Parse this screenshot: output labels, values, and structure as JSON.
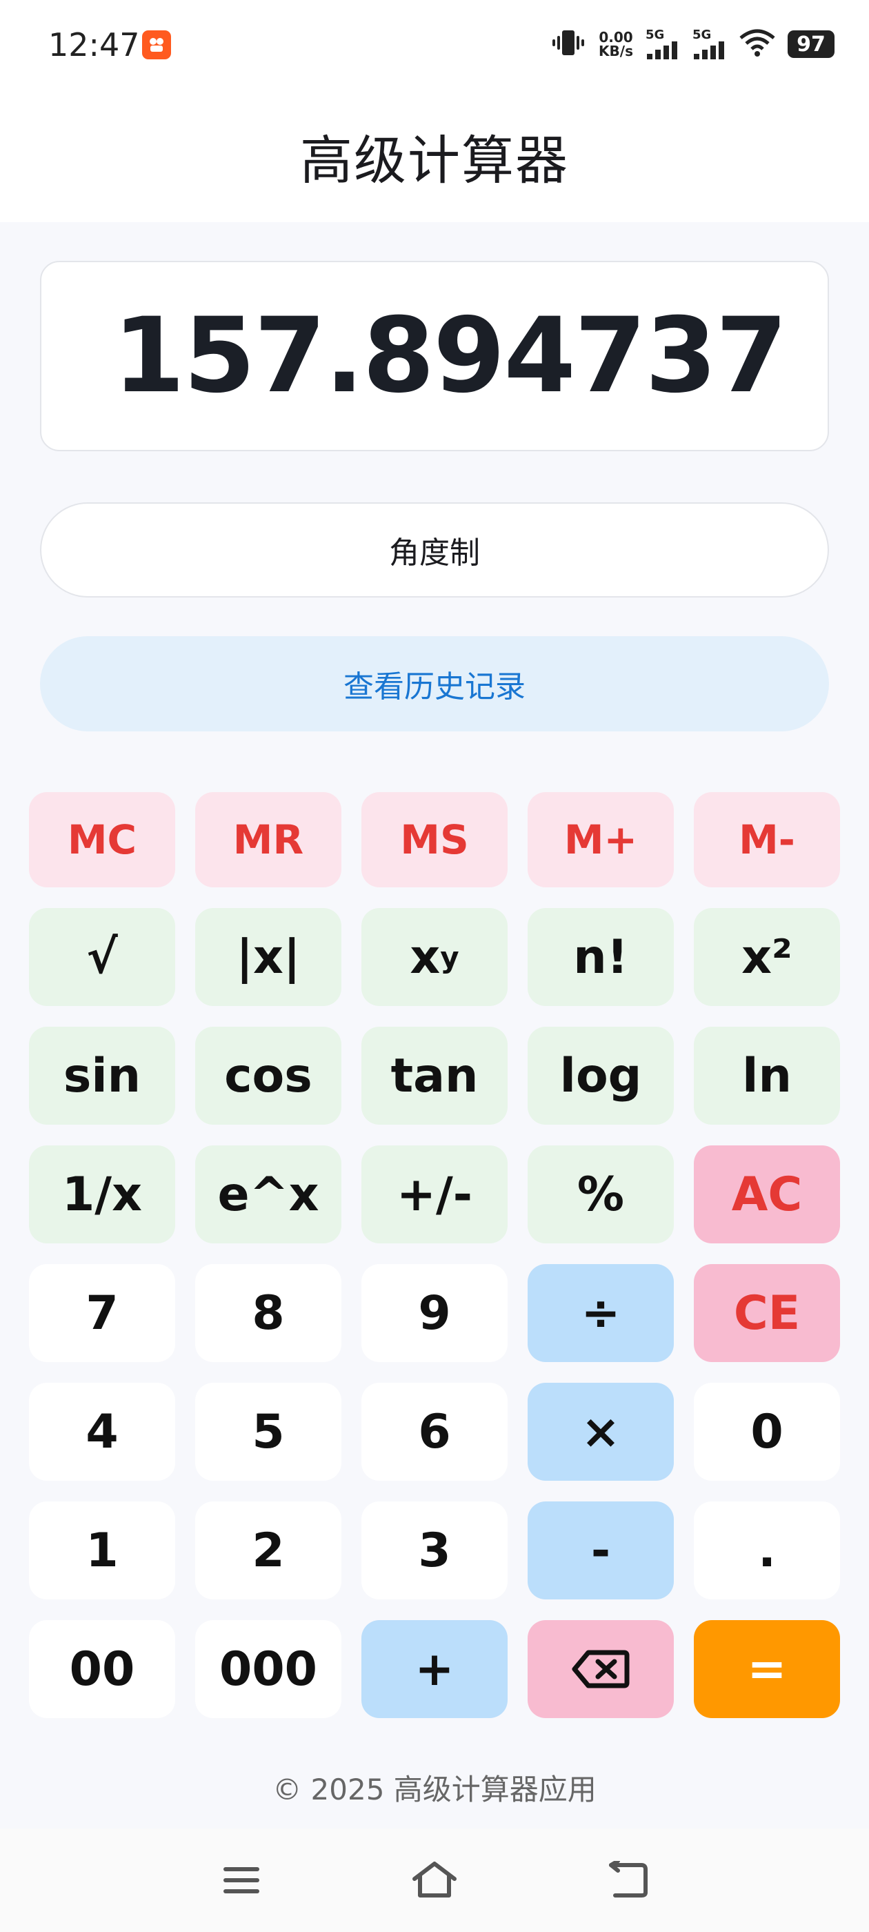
{
  "status_bar": {
    "time": "12:47",
    "net_speed_value": "0.00",
    "net_speed_unit": "KB/s",
    "signal_1": "5G",
    "signal_2": "5G",
    "battery": "97"
  },
  "header": {
    "title": "高级计算器"
  },
  "display": {
    "value": "157.894737"
  },
  "controls": {
    "angle_mode_label": "角度制",
    "history_label": "查看历史记录"
  },
  "keys": {
    "mc": "MC",
    "mr": "MR",
    "ms": "MS",
    "m_plus": "M+",
    "m_minus": "M-",
    "sqrt": "√",
    "abs": "|x|",
    "pow_base": "x",
    "pow_exp": "y",
    "factorial": "n!",
    "square": "x²",
    "sin": "sin",
    "cos": "cos",
    "tan": "tan",
    "log": "log",
    "ln": "ln",
    "reciprocal": "1/x",
    "exp": "e^x",
    "negate": "+/-",
    "percent": "%",
    "all_clear": "AC",
    "seven": "7",
    "eight": "8",
    "nine": "9",
    "divide": "÷",
    "clear_entry": "CE",
    "four": "4",
    "five": "5",
    "six": "6",
    "multiply": "×",
    "zero": "0",
    "one": "1",
    "two": "2",
    "three": "3",
    "minus": "-",
    "decimal": ".",
    "double_zero": "00",
    "triple_zero": "000",
    "plus": "+",
    "equals": "="
  },
  "footer": {
    "text": "© 2025 高级计算器应用"
  },
  "icons": {
    "backspace": "backspace-icon",
    "menu": "menu-icon",
    "home": "home-icon",
    "back": "back-icon"
  },
  "colors": {
    "memory_bg": "#fce4ec",
    "memory_text": "#e53935",
    "scientific_bg": "#e8f5e9",
    "operator_bg": "#bbdefb",
    "clear_bg": "#f8bbd0",
    "equals_bg": "#ff9800",
    "history_text": "#1976d2"
  }
}
